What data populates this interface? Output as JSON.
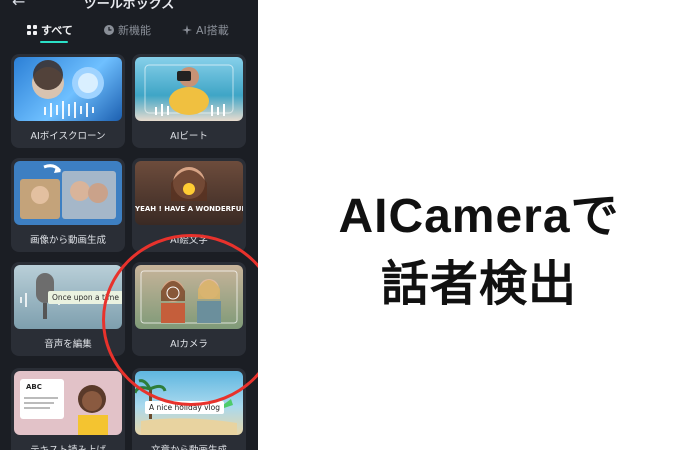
{
  "header": {
    "title": "ツールボックス",
    "back_icon": "back-icon"
  },
  "tabs": [
    {
      "label": "すべて",
      "icon": "grid-icon",
      "active": true
    },
    {
      "label": "新機能",
      "icon": "clock-icon",
      "active": false
    },
    {
      "label": "AI搭載",
      "icon": "sparkle-icon",
      "active": false
    }
  ],
  "tools": [
    {
      "label": "AIボイスクローン",
      "overlay": ""
    },
    {
      "label": "AIビート",
      "overlay": ""
    },
    {
      "label": "画像から動画生成",
      "overlay": ""
    },
    {
      "label": "AI絵文字",
      "overlay": "YEAH ! HAVE A WONDERFUL"
    },
    {
      "label": "音声を編集",
      "overlay": "Once upon a time"
    },
    {
      "label": "AIカメラ",
      "overlay": ""
    },
    {
      "label": "テキスト読み上げ",
      "overlay": "ABC"
    },
    {
      "label": "文章から動画生成",
      "overlay": "A nice holiday vlog"
    }
  ],
  "headline": {
    "line1": "AICameraで",
    "line2": "話者検出"
  },
  "colors": {
    "accent": "#2be0c7",
    "highlight": "#e8322c"
  }
}
